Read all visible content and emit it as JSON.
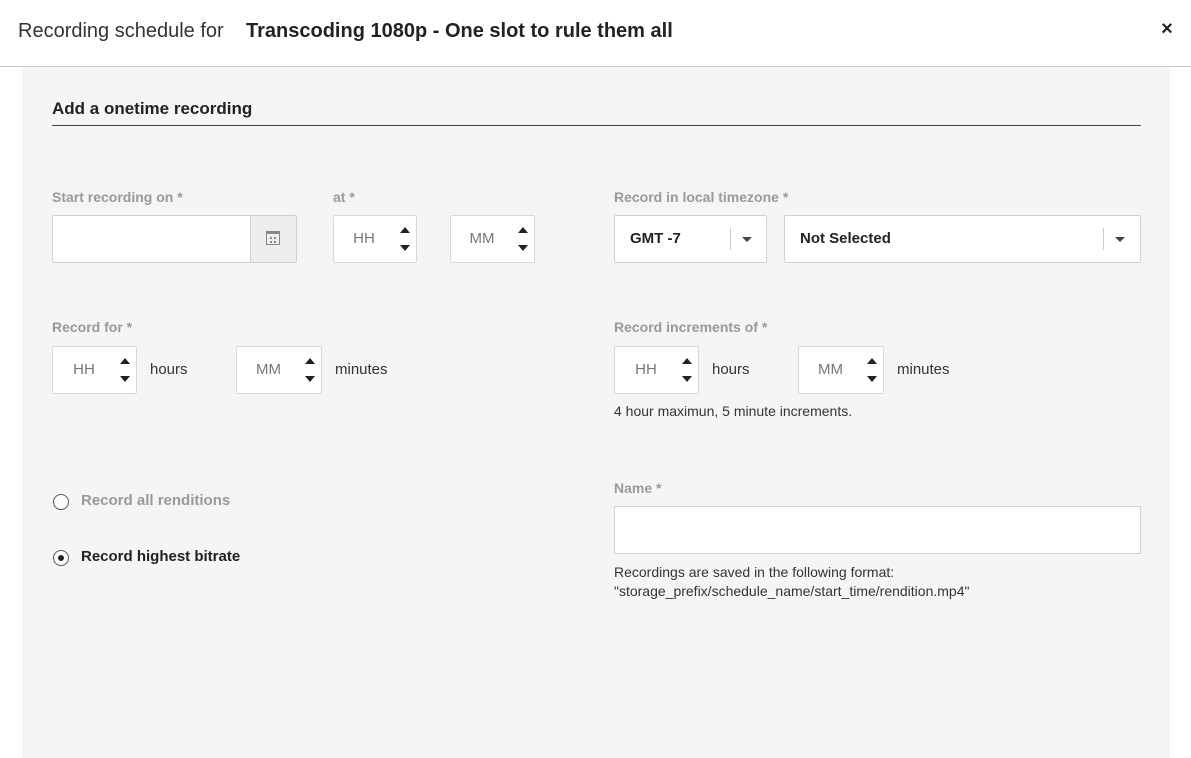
{
  "header": {
    "prefix": "Recording schedule for",
    "schedule_name": "Transcoding 1080p - One slot to rule them all",
    "close_symbol": "×"
  },
  "section": {
    "title": "Add a onetime recording"
  },
  "start": {
    "date_label": "Start recording on *",
    "date_value": "",
    "at_label": "at *",
    "hour_placeholder": "HH",
    "minute_placeholder": "MM"
  },
  "timezone": {
    "label": "Record in local timezone *",
    "offset": "GMT -7",
    "zone": "Not Selected"
  },
  "duration": {
    "label": "Record for *",
    "hour_placeholder": "HH",
    "hours_unit": "hours",
    "minute_placeholder": "MM",
    "minutes_unit": "minutes"
  },
  "increments": {
    "label": "Record increments of *",
    "hour_placeholder": "HH",
    "hours_unit": "hours",
    "minute_placeholder": "MM",
    "minutes_unit": "minutes",
    "hint": "4 hour maximun, 5 minute increments."
  },
  "renditions": {
    "options": [
      {
        "label": "Record all renditions",
        "selected": false
      },
      {
        "label": "Record highest bitrate",
        "selected": true
      }
    ]
  },
  "name": {
    "label": "Name *",
    "value": "",
    "hint_line1": "Recordings are saved in the following format:",
    "hint_line2": "\"storage_prefix/schedule_name/start_time/rendition.mp4\""
  },
  "colors": {
    "panel_bg": "#f5f5f5",
    "label_gray": "#999999",
    "text_dark": "#222222"
  },
  "icons": {
    "close": "close-icon",
    "calendar": "calendar-icon",
    "spin_up": "caret-up-icon",
    "spin_down": "caret-down-icon",
    "dropdown": "chevron-down-icon"
  }
}
